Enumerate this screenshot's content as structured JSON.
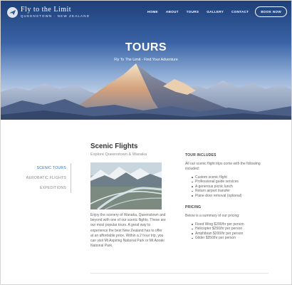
{
  "brand": {
    "title": "Fly to the Limit",
    "subtitle": "QUEENSTOWN · NEW ZEALAND"
  },
  "nav": {
    "items": [
      "HOME",
      "ABOUT",
      "TOURS",
      "GALLERY",
      "CONTACT"
    ],
    "cta": "BOOK NOW"
  },
  "hero": {
    "title": "TOURS",
    "tagline": "Fly To The Limit - Find Your Adventure"
  },
  "sidebar": {
    "items": [
      "SCENIC TOURS",
      "AEROBATIC FLIGHTS",
      "EXPEDITIONS"
    ],
    "active_color": "#2f73c0"
  },
  "content": {
    "title": "Scenic Flights",
    "subtitle": "Explore Queenstown & Wanaka",
    "description": "Enjoy the scenery of Wanaka, Queenstown and beyond with one of our scenic flights. These are our most popular tours. A great way to experience the best New Zealand has to offer at an affordable price. Within a 2 hour trip, you can visit Mt Aspiring National Park or Mt Aoraki National Park."
  },
  "tour_includes": {
    "heading": "TOUR INCLUDES",
    "intro": "All our scenic flight trips come with the following included:",
    "items": [
      "Custom scenic flight",
      "Professional guide services",
      "A generous picnic lunch",
      "Return airport transfer",
      "Plane door removal (optional)"
    ]
  },
  "pricing": {
    "heading": "PRICING",
    "intro": "Below is a summary of our pricing:",
    "items": [
      "Fixed Wing $200/hr per person",
      "Helicopter $250/hr per person",
      "Amphibian $200/hr per person",
      "Glider $350/hr per person"
    ]
  }
}
